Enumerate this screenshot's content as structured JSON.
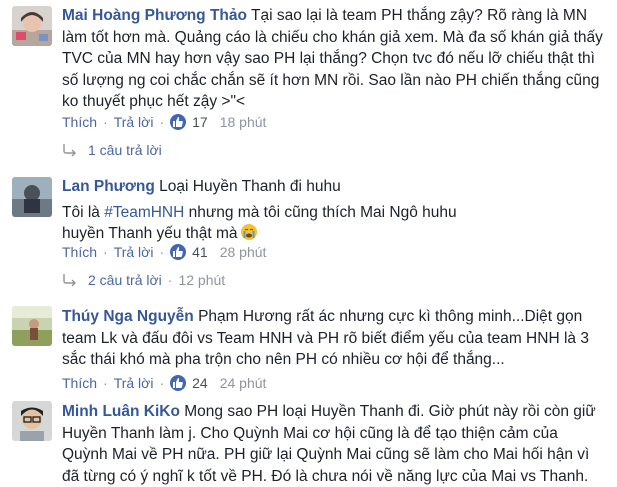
{
  "comments": [
    {
      "name": "Mai Hoàng Phương Thảo",
      "text": "Tại sao lại là team PH thắng zậy? Rõ ràng là MN làm tốt hơn mà. Quảng cáo là chiếu cho khán giả xem. Mà đa số khán giả thấy TVC của MN hay hơn vậy sao PH lại thắng? Chọn tvc đó nếu lỡ chiếu thật thì số lượng ng coi chắc chắn sẽ ít hơn MN rồi. Sao lần nào PH chiến thắng cũng ko thuyết phục hết zậy >\"<",
      "like": "Thích",
      "reply": "Trả lời",
      "likes": "17",
      "time": "18 phút",
      "replies": "1 câu trả lời"
    },
    {
      "name": "Lan Phương",
      "text1": "Loại Huyền Thanh đi huhu",
      "text2_pre": "Tôi là ",
      "hashtag": "#TeamHNH",
      "text2_post": " nhưng mà tôi cũng thích Mai Ngô huhu",
      "text3": "huyền Thanh yếu thật mà",
      "emoji": "crying-face-emoji",
      "like": "Thích",
      "reply": "Trả lời",
      "likes": "41",
      "time": "28 phút",
      "replies": "2 câu trả lời",
      "replies_time": "12 phút"
    },
    {
      "name": "Thúy Nga Nguyễn",
      "text": "Phạm Hương rất ác nhưng cực kì thông minh...Diệt gọn team Lk và đấu đôi vs Team HNH và PH rõ biết điểm yếu của team HNH là 3 sắc thái khó mà pha trộn cho nên PH có nhiều cơ hội để thắng...",
      "like": "Thích",
      "reply": "Trả lời",
      "likes": "24",
      "time": "24 phút"
    },
    {
      "name": "Minh Luân KiKo",
      "text": "Mong sao PH loại Huyền Thanh đi. Giờ phút này rồi còn giữ Huyền Thanh làm j. Cho Quỳnh Mai cơ hội cũng là để tạo thiện cảm của Quỳnh Mai về PH nữa. PH giữ lại Quỳnh Mai cũng sẽ làm cho Mai hối hận vì đã từng có ý nghĩ k tốt về PH. Đó là chưa nói về năng lực của Mai vs Thanh."
    }
  ]
}
